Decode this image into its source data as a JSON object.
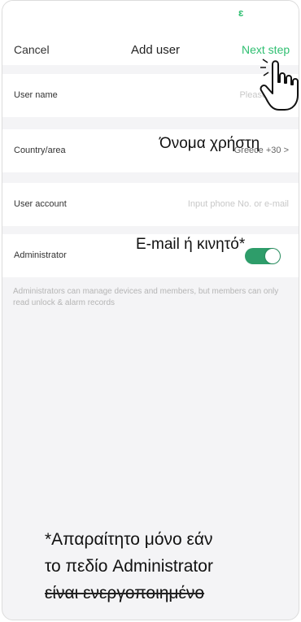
{
  "status": {
    "mark": "ɛ"
  },
  "nav": {
    "cancel_label": "Cancel",
    "title": "Add user",
    "next_label": "Next step"
  },
  "form": {
    "user_name": {
      "label": "User name",
      "placeholder": "Please input"
    },
    "country": {
      "label": "Country/area",
      "value": "Greece +30 >"
    },
    "account": {
      "label": "User account",
      "placeholder": "Input phone No. or e-mail"
    },
    "admin": {
      "label": "Administrator",
      "enabled": true
    }
  },
  "note": "Administrators can manage devices and members, but members can only read unlock & alarm records",
  "annotations": {
    "user_name_gr": "Όνομα χρήστη",
    "email_gr": "E-mail ή κινητό*",
    "footnote_line1": "*Απαραίτητο μόνο εάν",
    "footnote_line2": "το πεδίο Administrator",
    "footnote_line3": "είναι ενεργοποιημένο"
  },
  "colors": {
    "accent": "#2fbf71",
    "toggle_on": "#2e9d6a",
    "page_bg": "#f4f4f6"
  },
  "icons": {
    "pointer": "hand-pointer-icon"
  }
}
